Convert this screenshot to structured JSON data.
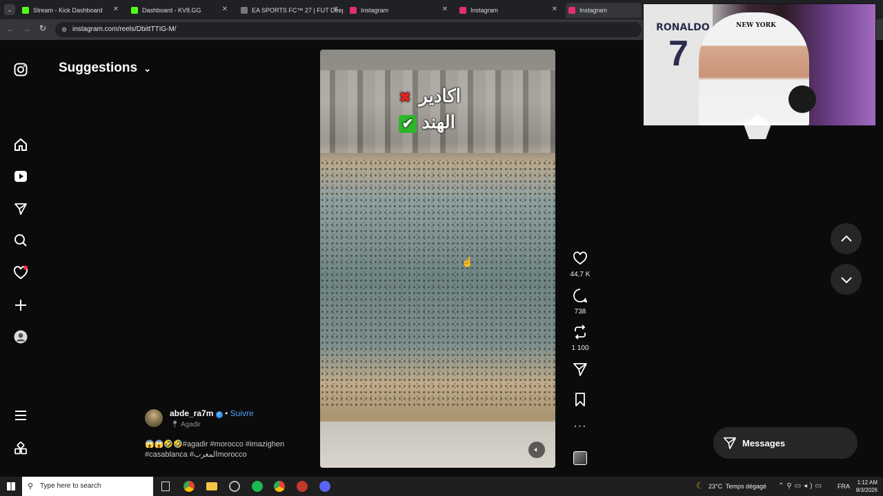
{
  "browser": {
    "tabs": [
      {
        "label": "Stream - Kick Dashboard",
        "color": "#53fc18"
      },
      {
        "label": "Dashboard - KV8.GG",
        "color": "#53fc18"
      },
      {
        "label": "EA SPORTS FC™ 27 | FUT Deep",
        "color": "#bbbbbb"
      },
      {
        "label": "Instagram",
        "color": "#e1306c"
      },
      {
        "label": "Instagram",
        "color": "#e1306c"
      },
      {
        "label": "Instagram",
        "color": "#e1306c"
      }
    ],
    "url": "instagram.com/reels/DbittTTIG-M/"
  },
  "sidebar": {
    "title": "Suggestions"
  },
  "video": {
    "overlay_line1": "اكادير",
    "overlay_line2": "الهند",
    "overlay_mark1": "✖",
    "overlay_mark2": "✔"
  },
  "actions": {
    "likes": "44,7 K",
    "comments": "738",
    "reposts": "1 100"
  },
  "post": {
    "username": "abde_ra7m",
    "separator": "•",
    "follow": "Suivre",
    "location": "Agadir",
    "caption_line1": "😱😱🤣🤣#agadir #morocco #imazighen",
    "caption_line2": "#casablanca #المغربmorocco"
  },
  "messages": {
    "label": "Messages"
  },
  "webcam": {
    "jersey_name": "RONALDO",
    "jersey_number": "7",
    "cap_text": "NEW YORK"
  },
  "taskbar": {
    "search_placeholder": "Type here to search",
    "weather": "23°C  Temps dégagé",
    "lang": "FRA",
    "time": "1:12 AM",
    "date": "8/3/2026"
  }
}
